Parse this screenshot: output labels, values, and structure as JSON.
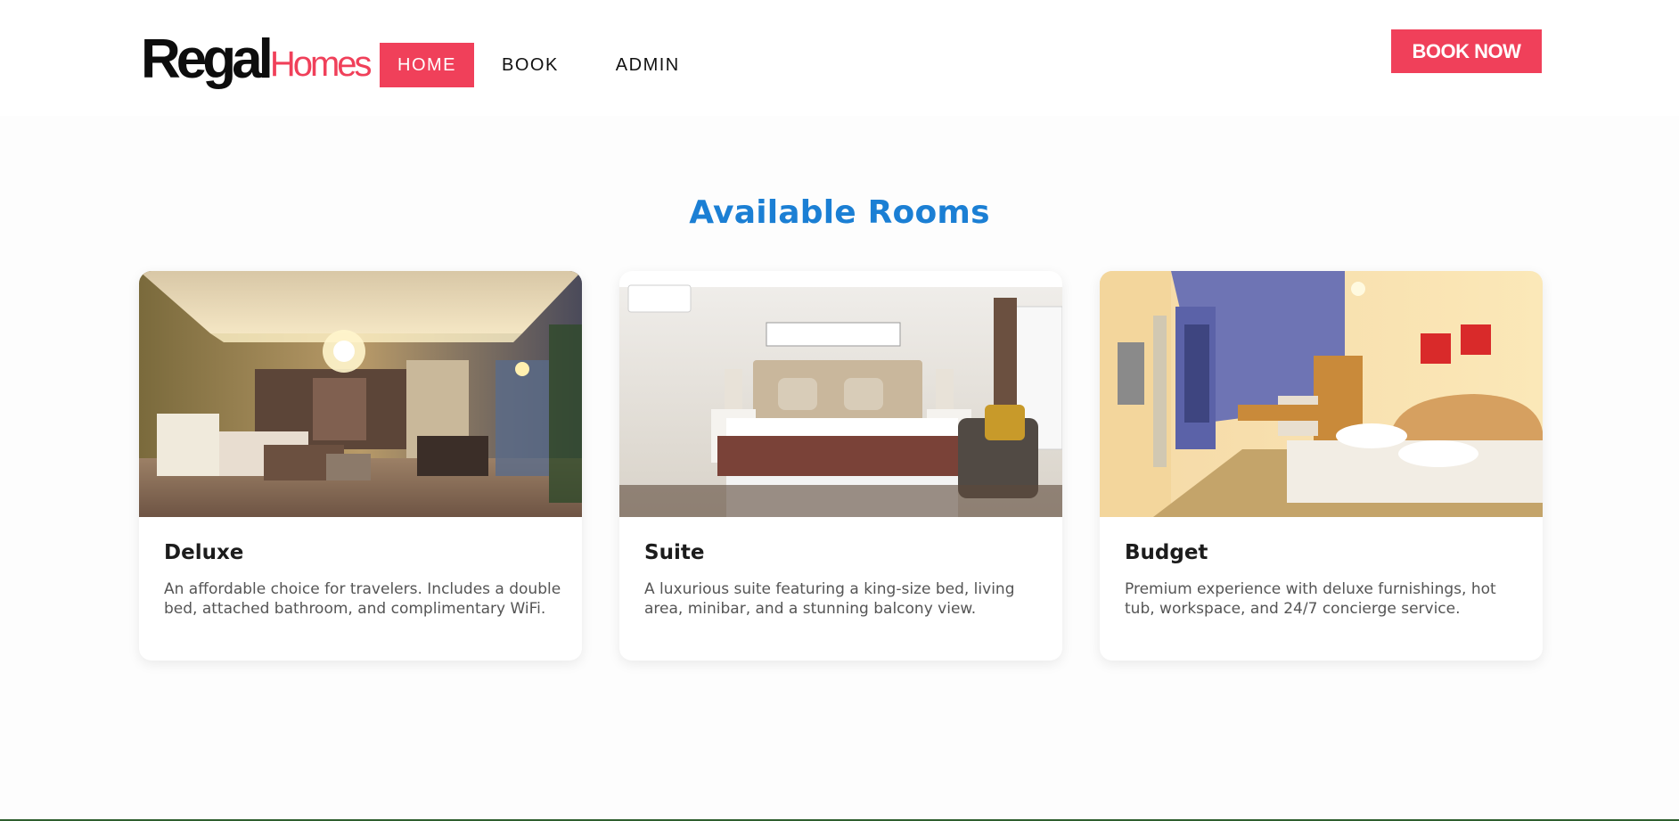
{
  "brand": {
    "name_primary": "Regal",
    "name_secondary": "Homes",
    "accent_color": "#f0405a"
  },
  "nav": {
    "items": [
      {
        "label": "HOME",
        "active": true
      },
      {
        "label": "BOOK",
        "active": false
      },
      {
        "label": "ADMIN",
        "active": false
      }
    ]
  },
  "header": {
    "cta_label": "BOOK NOW"
  },
  "rooms_section": {
    "title": "Available Rooms",
    "title_color": "#1b7fd4",
    "rooms": [
      {
        "name": "Deluxe",
        "description": "An affordable choice for travelers. Includes a double bed, attached bathroom, and complimentary WiFi."
      },
      {
        "name": "Suite",
        "description": "A luxurious suite featuring a king-size bed, living area, minibar, and a stunning balcony view."
      },
      {
        "name": "Budget",
        "description": "Premium experience with deluxe furnishings, hot tub, workspace, and 24/7 concierge service."
      }
    ]
  }
}
